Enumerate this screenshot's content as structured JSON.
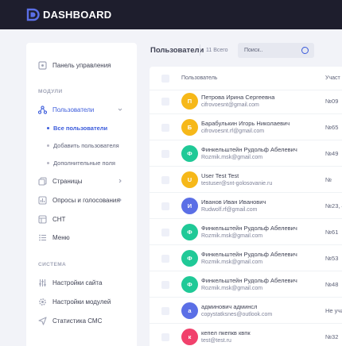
{
  "brand": {
    "name": "DASHBOARD",
    "accent": "#3b5bdb"
  },
  "sidebar": {
    "main": {
      "label": "Панель управления",
      "icon": "dashboard-icon"
    },
    "modules_heading": "МОДУЛИ",
    "users": {
      "label": "Пользователи",
      "icon": "users-icon"
    },
    "users_sub": [
      {
        "label": "Все пользователи",
        "active": true
      },
      {
        "label": "Добавить пользователя",
        "active": false
      },
      {
        "label": "Дополнительные поля",
        "active": false
      }
    ],
    "pages": {
      "label": "Страницы",
      "icon": "pages-icon"
    },
    "polls": {
      "label": "Опросы и голосования",
      "icon": "polls-icon"
    },
    "snt": {
      "label": "СНТ",
      "icon": "snt-icon"
    },
    "menu": {
      "label": "Меню",
      "icon": "menu-list-icon"
    },
    "system_heading": "СИСТЕМА",
    "site_settings": {
      "label": "Настройки сайта",
      "icon": "sliders-icon"
    },
    "module_settings": {
      "label": "Настройки модулей",
      "icon": "gear-icon"
    },
    "sms_stats": {
      "label": "Статистика СМС",
      "icon": "send-icon"
    }
  },
  "header": {
    "title": "Пользователи",
    "total": "11 Всего"
  },
  "search": {
    "placeholder": "Поиск.."
  },
  "table": {
    "columns": {
      "user": "Пользователь",
      "participant": "Участ"
    },
    "rows": [
      {
        "initial": "П",
        "color": "#f6b819",
        "name": "Петрова Ирина Сергеевна",
        "email": "cifrovoesnt@gmail.com",
        "num": "№09"
      },
      {
        "initial": "Б",
        "color": "#f6b819",
        "name": "Барабулькин Игорь Николаевич",
        "email": "cifrovoesnt.rf@gmail.com",
        "num": "№65"
      },
      {
        "initial": "Ф",
        "color": "#20c997",
        "name": "Финкельштейн Рудольф Абелевич",
        "email": "Rozmik.msk@gmail.com",
        "num": "№49"
      },
      {
        "initial": "U",
        "color": "#f6b819",
        "name": "User Test Test",
        "email": "testuser@snt-golosovanie.ru",
        "num": "№"
      },
      {
        "initial": "И",
        "color": "#5b6fe6",
        "name": "Иванов Иван Иванович",
        "email": "Rudwolf.rf@gmail.com",
        "num": "№23, 4"
      },
      {
        "initial": "Ф",
        "color": "#20c997",
        "name": "Финкельштейн Рудольф Абелевич",
        "email": "Rozmik.msk@gmail.com",
        "num": "№61"
      },
      {
        "initial": "Ф",
        "color": "#20c997",
        "name": "Финкельштейн Рудольф Абелевич",
        "email": "Rozmik.msk@gmail.com",
        "num": "№53"
      },
      {
        "initial": "Ф",
        "color": "#20c997",
        "name": "Финкельштейн Рудольф Абелевич",
        "email": "Rozmik.msk@gmail.com",
        "num": "№48"
      },
      {
        "initial": "а",
        "color": "#5b6fe6",
        "name": "админович админсл",
        "email": "copystatksnes@outlook.com",
        "num": "Не уча"
      },
      {
        "initial": "к",
        "color": "#f1416c",
        "name": "кепел пкепкв квпк",
        "email": "test@test.ru",
        "num": "№32"
      }
    ]
  }
}
